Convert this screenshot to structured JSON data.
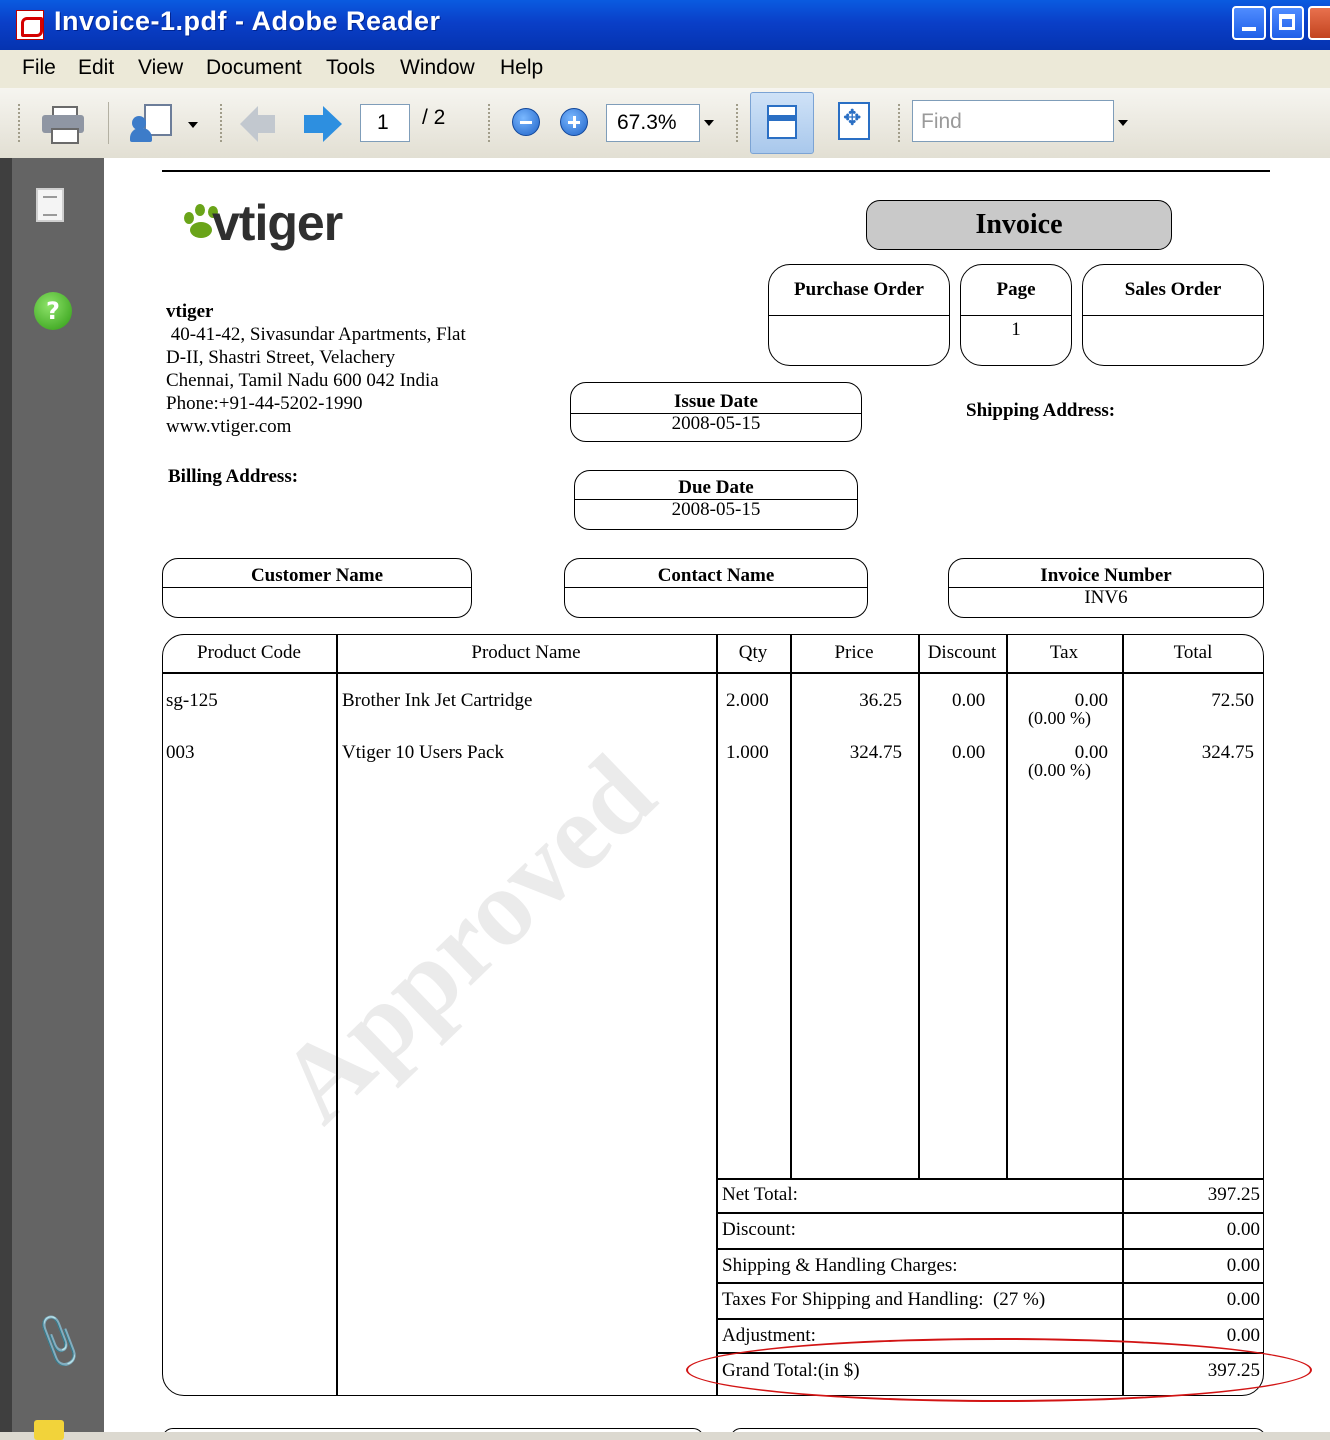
{
  "window": {
    "title": "Invoice-1.pdf - Adobe Reader"
  },
  "menu": [
    "File",
    "Edit",
    "View",
    "Document",
    "Tools",
    "Window",
    "Help"
  ],
  "toolbar": {
    "page_current": "1",
    "page_total": "/ 2",
    "zoom": "67.3%",
    "find_placeholder": "Find"
  },
  "invoice": {
    "logo_text": "vtiger",
    "title": "Invoice",
    "company": {
      "name": "vtiger",
      "address1": " 40-41-42, Sivasundar Apartments, Flat",
      "address2": "D-II, Shastri Street, Velachery",
      "address3": "Chennai, Tamil Nadu 600 042 India",
      "phone": "Phone:+91-44-5202-1990",
      "web": "www.vtiger.com"
    },
    "purchase_order": {
      "label": "Purchase Order",
      "value": ""
    },
    "page": {
      "label": "Page",
      "value": "1"
    },
    "sales_order": {
      "label": "Sales Order",
      "value": ""
    },
    "issue_date": {
      "label": "Issue Date",
      "value": "2008-05-15"
    },
    "due_date": {
      "label": "Due Date",
      "value": "2008-05-15"
    },
    "shipping_address_label": "Shipping Address:",
    "billing_address_label": "Billing Address:",
    "customer_name": {
      "label": "Customer Name",
      "value": ""
    },
    "contact_name": {
      "label": "Contact Name",
      "value": ""
    },
    "invoice_number": {
      "label": "Invoice Number",
      "value": "INV6"
    },
    "columns": [
      "Product Code",
      "Product Name",
      "Qty",
      "Price",
      "Discount",
      "Tax",
      "Total"
    ],
    "rows": [
      {
        "code": "sg-125",
        "name": "Brother Ink Jet Cartridge",
        "qty": "2.000",
        "price": "36.25",
        "discount": "0.00",
        "tax": "0.00",
        "tax_pct": "(0.00 %)",
        "total": "72.50"
      },
      {
        "code": "003",
        "name": "Vtiger 10 Users Pack",
        "qty": "1.000",
        "price": "324.75",
        "discount": "0.00",
        "tax": "0.00",
        "tax_pct": "(0.00 %)",
        "total": "324.75"
      }
    ],
    "summary": [
      {
        "label": "Net Total:",
        "value": "397.25"
      },
      {
        "label": "Discount:",
        "value": "0.00"
      },
      {
        "label": "Shipping & Handling Charges:",
        "value": "0.00"
      },
      {
        "label": "Taxes For Shipping and Handling:  (27 %)",
        "value": "0.00"
      },
      {
        "label": "Adjustment:",
        "value": "0.00"
      },
      {
        "label": "Grand Total:(in $)",
        "value": "397.25"
      }
    ],
    "watermark": "Approved",
    "highlight_color": "#d21414"
  }
}
